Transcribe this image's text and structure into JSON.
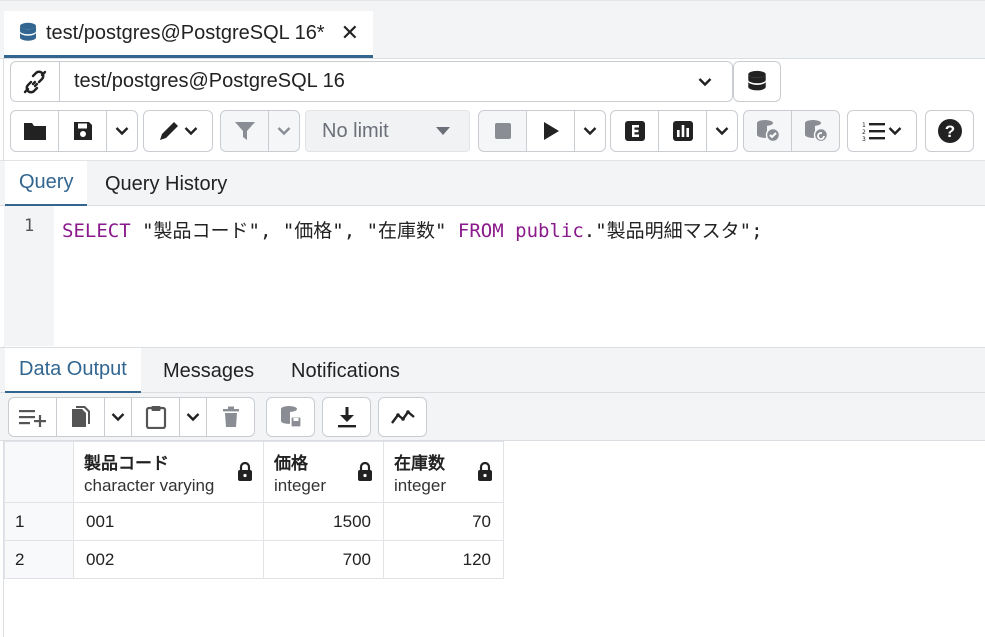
{
  "window": {
    "file_tab_title": "test/postgres@PostgreSQL 16*",
    "close_glyph": "✕"
  },
  "connection": {
    "selected": "test/postgres@PostgreSQL 16"
  },
  "toolbar": {
    "limit": "No limit"
  },
  "query_tabs": [
    {
      "label": "Query",
      "active": true
    },
    {
      "label": "Query History",
      "active": false
    }
  ],
  "editor": {
    "line_number": "1",
    "tokens": [
      {
        "text": "SELECT",
        "kw": true
      },
      {
        "text": " \"製品コード\", \"価格\", \"在庫数\" ",
        "kw": false
      },
      {
        "text": "FROM",
        "kw": true
      },
      {
        "text": " ",
        "kw": false
      },
      {
        "text": "public",
        "kw": true
      },
      {
        "text": ".\"製品明細マスタ\";",
        "kw": false
      }
    ]
  },
  "output_tabs": [
    {
      "label": "Data Output",
      "active": true
    },
    {
      "label": "Messages",
      "active": false
    },
    {
      "label": "Notifications",
      "active": false
    }
  ],
  "results": {
    "columns": [
      {
        "name": "製品コード",
        "type": "character varying"
      },
      {
        "name": "価格",
        "type": "integer"
      },
      {
        "name": "在庫数",
        "type": "integer"
      }
    ],
    "rows": [
      {
        "num": "1",
        "cells": [
          "001",
          "1500",
          "70"
        ]
      },
      {
        "num": "2",
        "cells": [
          "002",
          "700",
          "120"
        ]
      }
    ]
  },
  "colors": {
    "accent": "#326690",
    "keyword": "#8a1a8c"
  }
}
